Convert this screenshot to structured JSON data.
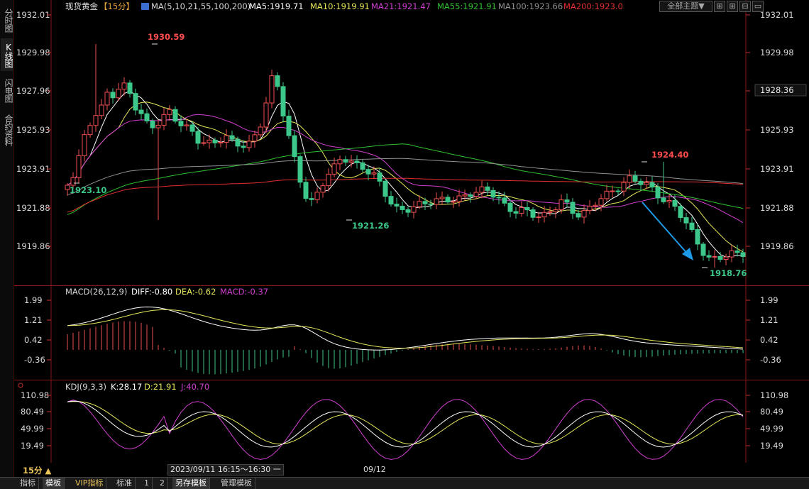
{
  "left_tabs": [
    {
      "label": "分时图",
      "active": false
    },
    {
      "label": "K线图",
      "active": true
    },
    {
      "label": "闪电图",
      "active": false
    },
    {
      "label": "合约资料",
      "active": false
    }
  ],
  "header": {
    "symbol": "现货黄金",
    "period_tag": "【15分】",
    "ma_title": "MA(5,10,21,55,100,200)",
    "ma5": "MA5:1919.71",
    "ma10": "MA10:1919.91",
    "ma21": "MA21:1921.47",
    "ma55": "MA55:1921.91",
    "ma100": "MA100:1923.66",
    "ma200": "MA200:1923.0",
    "theme_button": "全部主题▼"
  },
  "price_axis": {
    "ticks": [
      "1932.01",
      "1929.98",
      "1927.96",
      "1925.93",
      "1923.91",
      "1921.88",
      "1919.86"
    ],
    "current_price": "1928.36"
  },
  "price_annotations": [
    {
      "label": "1930.59",
      "color": "#ff4d4d"
    },
    {
      "label": "1923.10",
      "color": "#3cc88a"
    },
    {
      "label": "1921.26",
      "color": "#3cc88a"
    },
    {
      "label": "1924.40",
      "color": "#ff4d4d"
    },
    {
      "label": "1918.76",
      "color": "#3cc88a"
    }
  ],
  "macd": {
    "title": "MACD(26,12,9)",
    "diff": "DIFF:-0.80",
    "dea": "DEA:-0.62",
    "macd": "MACD:-0.37",
    "ticks": [
      "1.99",
      "1.21",
      "0.42",
      "-0.36"
    ]
  },
  "kdj": {
    "title": "KDJ(9,3,3)",
    "k": "K:28.17",
    "d": "D:21.91",
    "j": "J:40.70",
    "ticks": [
      "110.98",
      "80.49",
      "49.99",
      "19.49"
    ]
  },
  "status": {
    "period": "15分 ▲",
    "cursor_time": "2023/09/11 16:15～16:30 一",
    "date_label": "09/12"
  },
  "bottom_tabs": [
    {
      "label": "指标",
      "selected": false
    },
    {
      "label": "模板",
      "selected": true
    },
    {
      "label": "VIP指标",
      "selected": false,
      "vip": true
    },
    {
      "label": "标准",
      "selected": false
    },
    {
      "label": "1",
      "selected": false
    },
    {
      "label": "2",
      "selected": false
    },
    {
      "label": "另存模板",
      "selected": true
    },
    {
      "label": "管理模板",
      "selected": false
    }
  ],
  "colors": {
    "up": "#f05050",
    "down": "#3cc88a",
    "ma5": "#ffffff",
    "ma10": "#e6e65a",
    "ma21": "#d040d0",
    "ma55": "#30c030",
    "ma100": "#909090",
    "ma200": "#e03030",
    "axis_red": "#c03030",
    "arrow": "#1e9be8"
  }
}
